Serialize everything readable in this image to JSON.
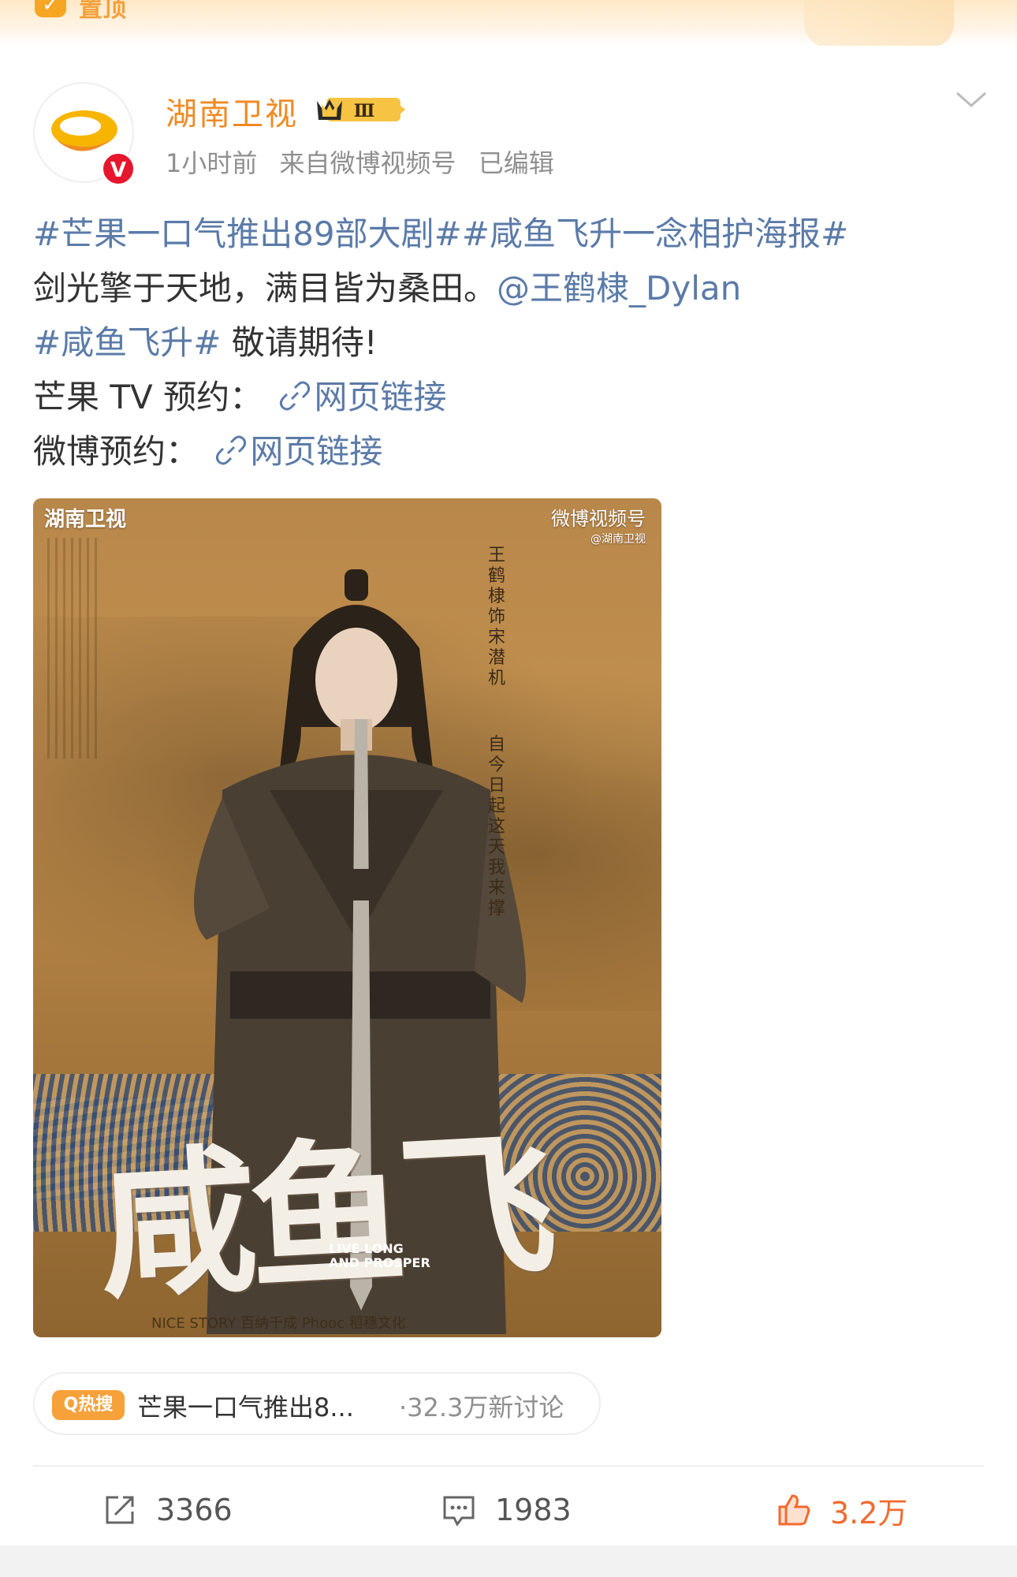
{
  "banner": {
    "pin_label": "置顶"
  },
  "author": {
    "name": "湖南卫视",
    "verified_mark": "V",
    "vip_level": "Ⅲ",
    "time": "1小时前",
    "source": "来自微博视频号",
    "edited": "已编辑"
  },
  "post": {
    "line1_topic1": "#芒果一口气推出89部大剧#",
    "line1_topic2": "#咸鱼飞升一念相护海报#",
    "line2_text": "剑光擎于天地，满目皆为桑田。",
    "line2_mention": "@王鹤棣_Dylan",
    "line3_topic": "#咸鱼飞升#",
    "line3_text": " 敬请期待!",
    "line4_label": "芒果 TV 预约：",
    "line4_link": "网页链接",
    "line5_label": "微博预约：",
    "line5_link": "网页链接"
  },
  "poster": {
    "brand_left": "湖南卫视",
    "brand_right": "微博视频号",
    "brand_right_sub": "@湖南卫视",
    "credit_vertical": "王鹤棣 饰 宋潜机",
    "tagline_vertical": "自今日起 这天我来撑",
    "title": "咸鱼飞升",
    "en_title_1": "LIVE LONG",
    "en_title_2": "AND PROSPER",
    "bottom_credits": "NICE STORY   百纳千成   Phooc 稻穗文化"
  },
  "hot_search": {
    "badge": "Q热搜",
    "text": "芒果一口气推出8...",
    "count": "·32.3万新讨论"
  },
  "actions": {
    "repost_count": "3366",
    "comment_count": "1983",
    "like_count": "3.2万"
  },
  "colors": {
    "brand_orange": "#f08a24",
    "link_blue": "#5b7ba8",
    "like_orange": "#f26a2e",
    "hot_badge": "#f7a13b"
  }
}
